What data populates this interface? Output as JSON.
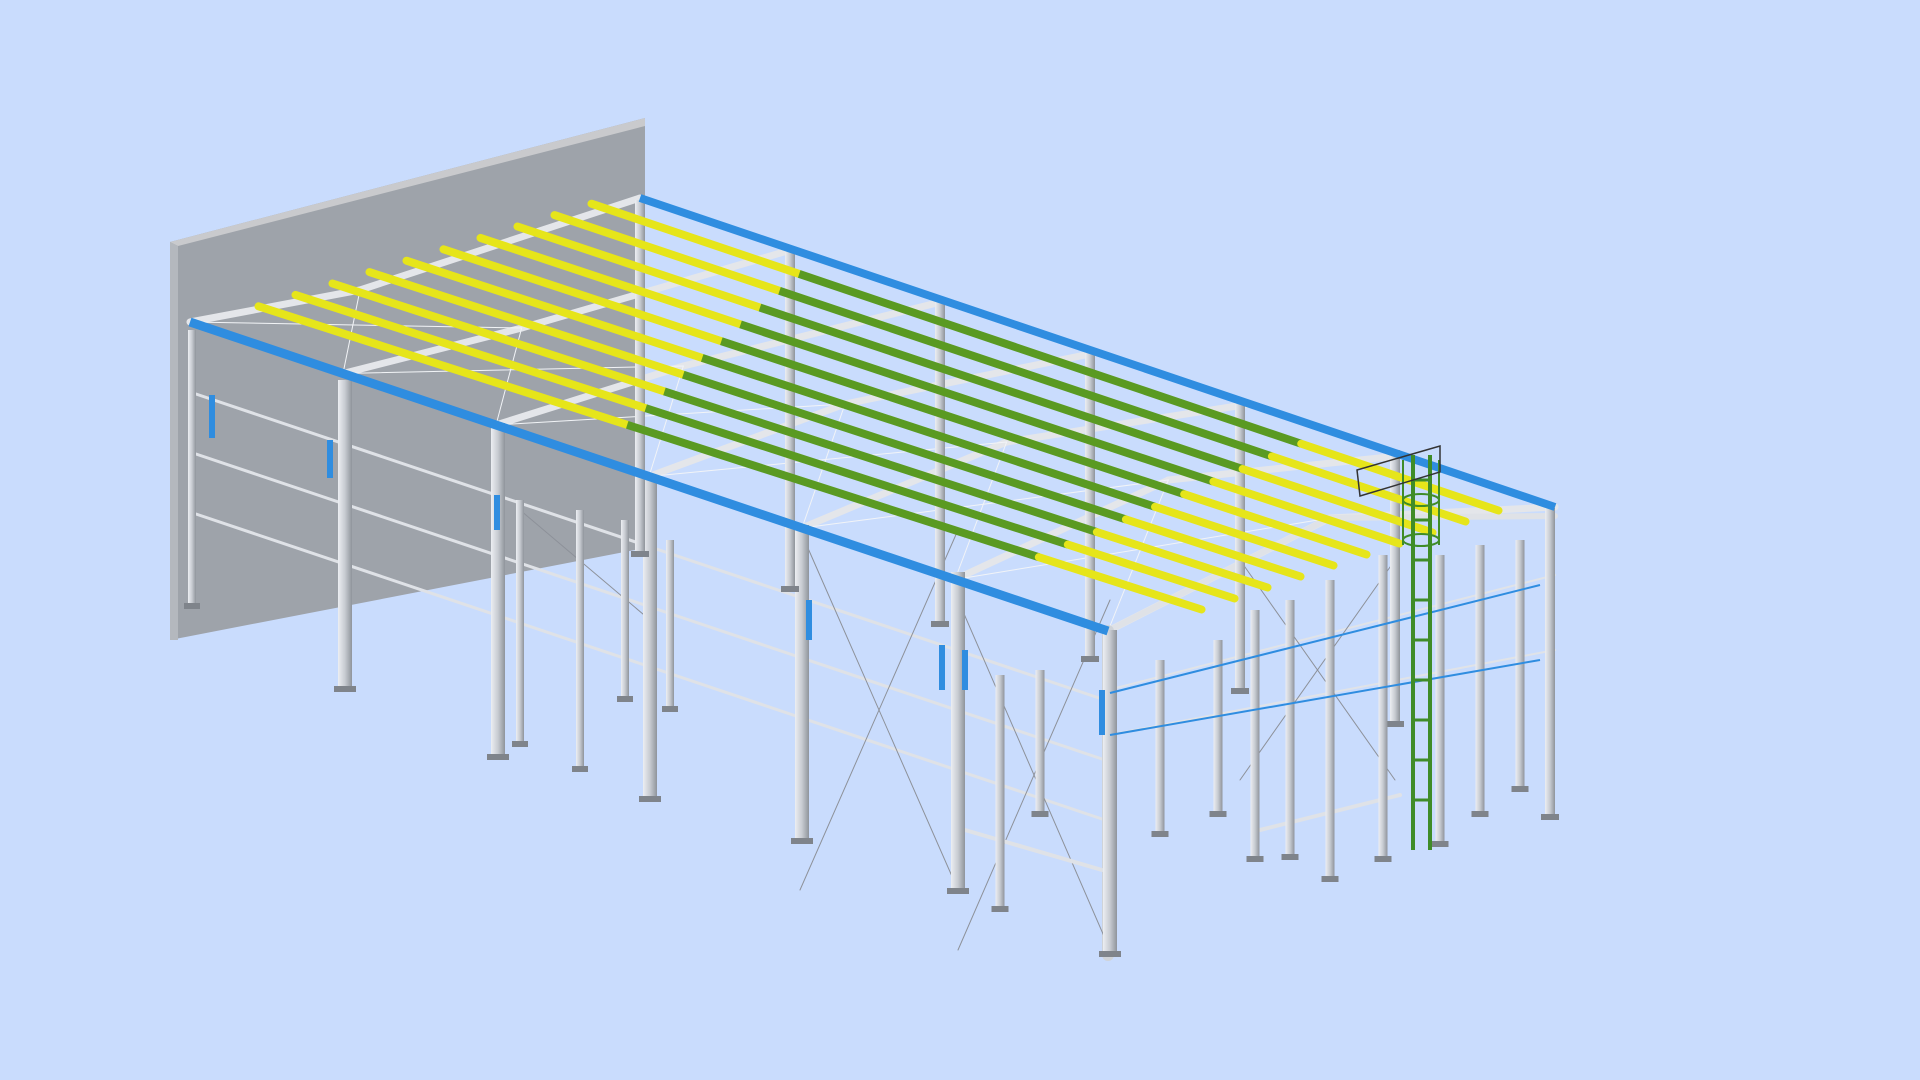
{
  "scene": {
    "subject": "steel-frame-building-3d-model",
    "colors": {
      "background": "#c9dcfd",
      "wall": "#9fa4ab",
      "wall_top": "#c8c9cc",
      "steel": "#d5d8dd",
      "steel_shade": "#9ea3aa",
      "eave_beam": "#2f8de0",
      "purlin_yellow": "#e6e51a",
      "purlin_green": "#5a9a22",
      "brace": "#8d9199",
      "ladder": "#3f8c28"
    },
    "frames": 7,
    "purlins_per_side": 10
  }
}
